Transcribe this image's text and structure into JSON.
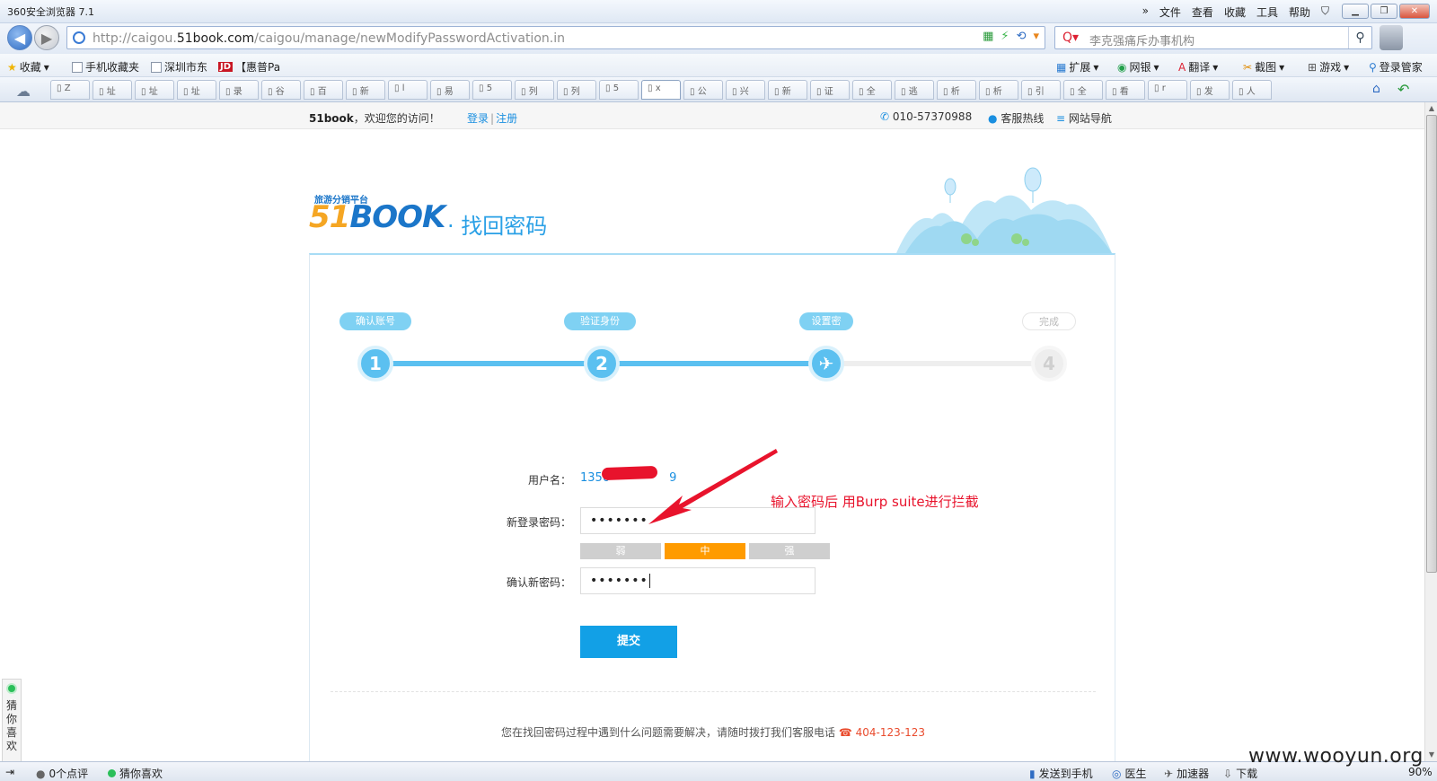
{
  "browser": {
    "title": "360安全浏览器 7.1",
    "menus": [
      "»",
      "文件",
      "查看",
      "收藏",
      "工具",
      "帮助"
    ],
    "url_prefix": "http://caigou.",
    "url_host": "51book.com",
    "url_path": "/caigou/manage/newModifyPasswordActivation.in",
    "search_text": "李克强痛斥办事机构",
    "favorites": {
      "fav": "收藏",
      "mobile": "手机收藏夹",
      "shenzhen": "深圳市东",
      "jd_text": "【惠普Pa",
      "jd_logo": "JD",
      "ext": "扩展",
      "wangyin": "网银",
      "translate": "翻译",
      "screenshot": "截图",
      "games": "游戏",
      "login_mgr": "登录管家"
    },
    "tabs": [
      "Z",
      "址",
      "址",
      "址",
      "录",
      "谷",
      "百",
      "新",
      "l",
      "易",
      "5",
      "列",
      "列",
      "5",
      "x",
      "公",
      "兴",
      "新",
      "证",
      "全",
      "逃",
      "析",
      "析",
      "引",
      "全",
      "看",
      "r",
      "发",
      "人"
    ]
  },
  "site": {
    "brand": "51book",
    "welcome": "，欢迎您的访问！",
    "login": "登录",
    "sep": "|",
    "register": "注册",
    "hotline_num": "010-57370988",
    "service": "客服热线",
    "sitenav": "网站导航",
    "logo_slogan": "旅游分销平台",
    "logo_five": "51",
    "logo_rest": "BOOK",
    "page_title": "· 找回密码"
  },
  "steps": [
    {
      "label": "确认账号",
      "num": "1",
      "state": "done"
    },
    {
      "label": "验证身份",
      "num": "2",
      "state": "done"
    },
    {
      "label": "设置密",
      "num": "✈",
      "state": "current"
    },
    {
      "label": "完成",
      "num": "4",
      "state": "todo"
    }
  ],
  "form": {
    "username_label": "用户名：",
    "username_value": "1350",
    "username_tail": "9",
    "new_pw_label": "新登录密码：",
    "new_pw_value": "•••••••",
    "confirm_pw_label": "确认新密码：",
    "confirm_pw_value": "•••••••",
    "strength": [
      "弱",
      "中",
      "强"
    ],
    "strength_level": "中",
    "submit": "提交"
  },
  "annotation": "输入密码后 用Burp suite进行拦截",
  "help": {
    "text": "您在找回密码过程中遇到什么问题需要解决，请随时拨打我们客服电话",
    "tel": "404-123-123"
  },
  "sidewidget": {
    "text": "猜你喜欢"
  },
  "statusbar": {
    "comments": "0个点评",
    "guess": "猜你喜欢",
    "send_phone": "发送到手机",
    "doctor": "医生",
    "accelerator": "加速器",
    "download": "下载",
    "zoom": "90%"
  },
  "watermark": "www.wooyun.org",
  "colors": {
    "accent": "#12a0e6",
    "step": "#5bc0f0",
    "strength_mid": "#ff9b00",
    "annotation": "#e8132c"
  }
}
